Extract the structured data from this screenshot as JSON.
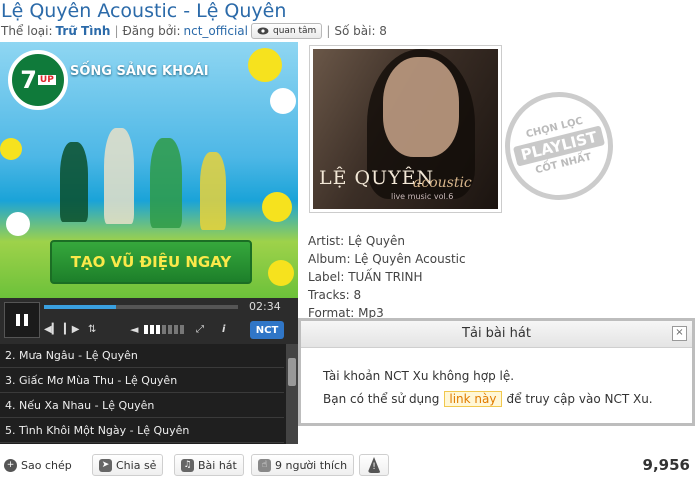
{
  "header": {
    "title": "Lệ Quyên Acoustic - Lệ Quyên",
    "genre_label": "Thể loại:",
    "genre": "Trữ Tình",
    "uploader_label": "Đăng bởi:",
    "uploader": "nct_official",
    "follow_label": "quan tâm",
    "count_label": "Số bài: 8"
  },
  "ad": {
    "logo_text": "7",
    "logo_sub": "UP",
    "slogan": "SỐNG SẢNG KHOÁI",
    "cta": "TẠO VŨ ĐIỆU NGAY"
  },
  "player": {
    "time": "02:34",
    "progress": 0.37,
    "volume_level": 3,
    "volume_total": 7,
    "brand": "NCT"
  },
  "playlist": [
    "2. Mưa Ngâu - Lệ Quyên",
    "3. Giấc Mơ Mùa Thu - Lệ Quyên",
    "4. Nếu Xa Nhau - Lệ Quyên",
    "5. Tình Khôi Một Ngày - Lệ Quyên"
  ],
  "cover": {
    "artist_text": "LỆ QUYÊN",
    "subtitle": "acoustic",
    "live_text": "live music vol.6"
  },
  "stamp": {
    "top": "CHỌN LỌC",
    "mid": "PLAYLIST",
    "bot": "CỐT NHẤT"
  },
  "info": {
    "artist": "Artist: Lệ Quyên",
    "album": "Album: Lệ Quyên Acoustic",
    "label": "Label: TUẤN TRINH",
    "tracks": "Tracks: 8",
    "format": "Format: Mp3"
  },
  "dialog": {
    "title": "Tải bài hát",
    "close": "×",
    "message1": "Tài khoản NCT Xu không hợp lệ.",
    "message2_pre": "Bạn có thể sử dụng",
    "link": "link này",
    "message2_post": "để truy cập vào NCT Xu."
  },
  "bottom": {
    "copy": "Sao chép",
    "share": "Chia sẻ",
    "song": "Bài hát",
    "likes": "9 người thích",
    "views": "9,956"
  }
}
